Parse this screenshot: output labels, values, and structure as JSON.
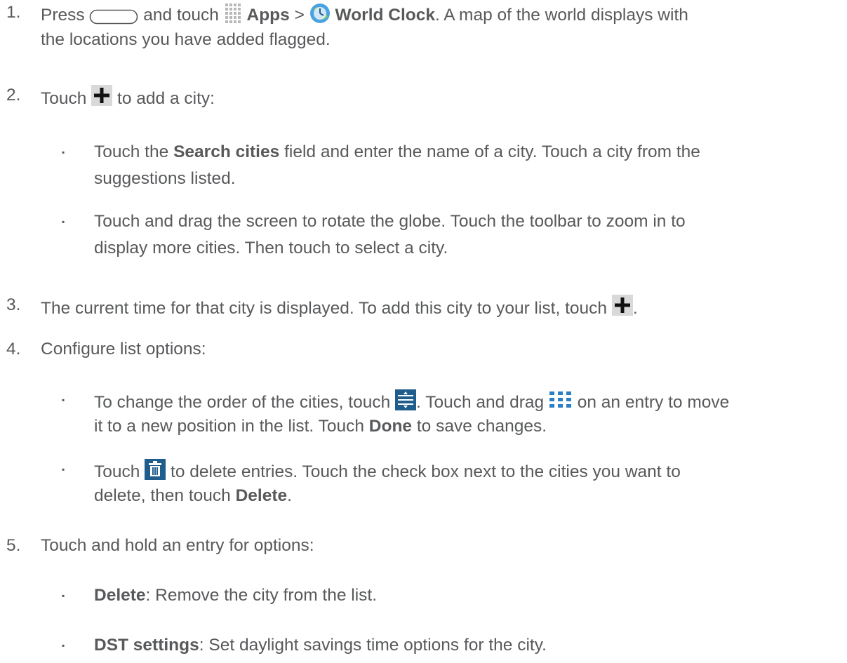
{
  "steps": [
    {
      "num": "1.",
      "line1_pre": "Press",
      "line1_mid": "and touch",
      "apps": "Apps",
      "sep": ">",
      "world_clock": "World Clock",
      "line1_post": ". A map of the world displays with",
      "line2": "the locations you have added flagged."
    },
    {
      "num": "2.",
      "pre": "Touch",
      "post": "to add a city:",
      "bullets": [
        {
          "pre": "Touch the",
          "bold": "Search cities",
          "post": "field and enter the name of a city. Touch a city from the",
          "line2": "suggestions listed."
        },
        {
          "line1": "Touch and drag the screen to rotate the globe. Touch the toolbar to zoom in to",
          "line2": "display more cities. Then touch to select a city."
        }
      ]
    },
    {
      "num": "3.",
      "pre": "The current time for that city is displayed. To add this city to your list, touch",
      "post": "."
    },
    {
      "num": "4.",
      "text": "Configure list options:",
      "bullets": [
        {
          "pre": "To change the order of the cities, touch",
          "mid": ". Touch and drag",
          "post": "on an entry to move",
          "line2_pre": "it to a new position in the list. Touch",
          "line2_bold": "Done",
          "line2_post": "to save changes."
        },
        {
          "pre": "Touch",
          "post": "to delete entries. Touch the check box next to the cities you want to",
          "line2_pre": "delete, then touch",
          "line2_bold": "Delete",
          "line2_post": "."
        }
      ]
    },
    {
      "num": "5.",
      "text": "Touch and hold an entry for options:",
      "bullets": [
        {
          "bold": "Delete",
          "post": ": Remove the city from the list."
        },
        {
          "bold": "DST settings",
          "post": ": Set daylight savings time options for the city."
        }
      ]
    }
  ],
  "bullet_char": "▪",
  "icons": {
    "home_key": "home-key-icon",
    "apps": "apps-grid-icon",
    "world_clock": "world-clock-icon",
    "add": "add-plus-icon",
    "reorder": "reorder-icon",
    "drag": "drag-handle-icon",
    "delete": "trash-icon"
  },
  "colors": {
    "text": "#58595b",
    "blue": "#2b7fc4",
    "dark_blue": "#1f5d8c",
    "icon_bg": "#d9d9d9"
  }
}
